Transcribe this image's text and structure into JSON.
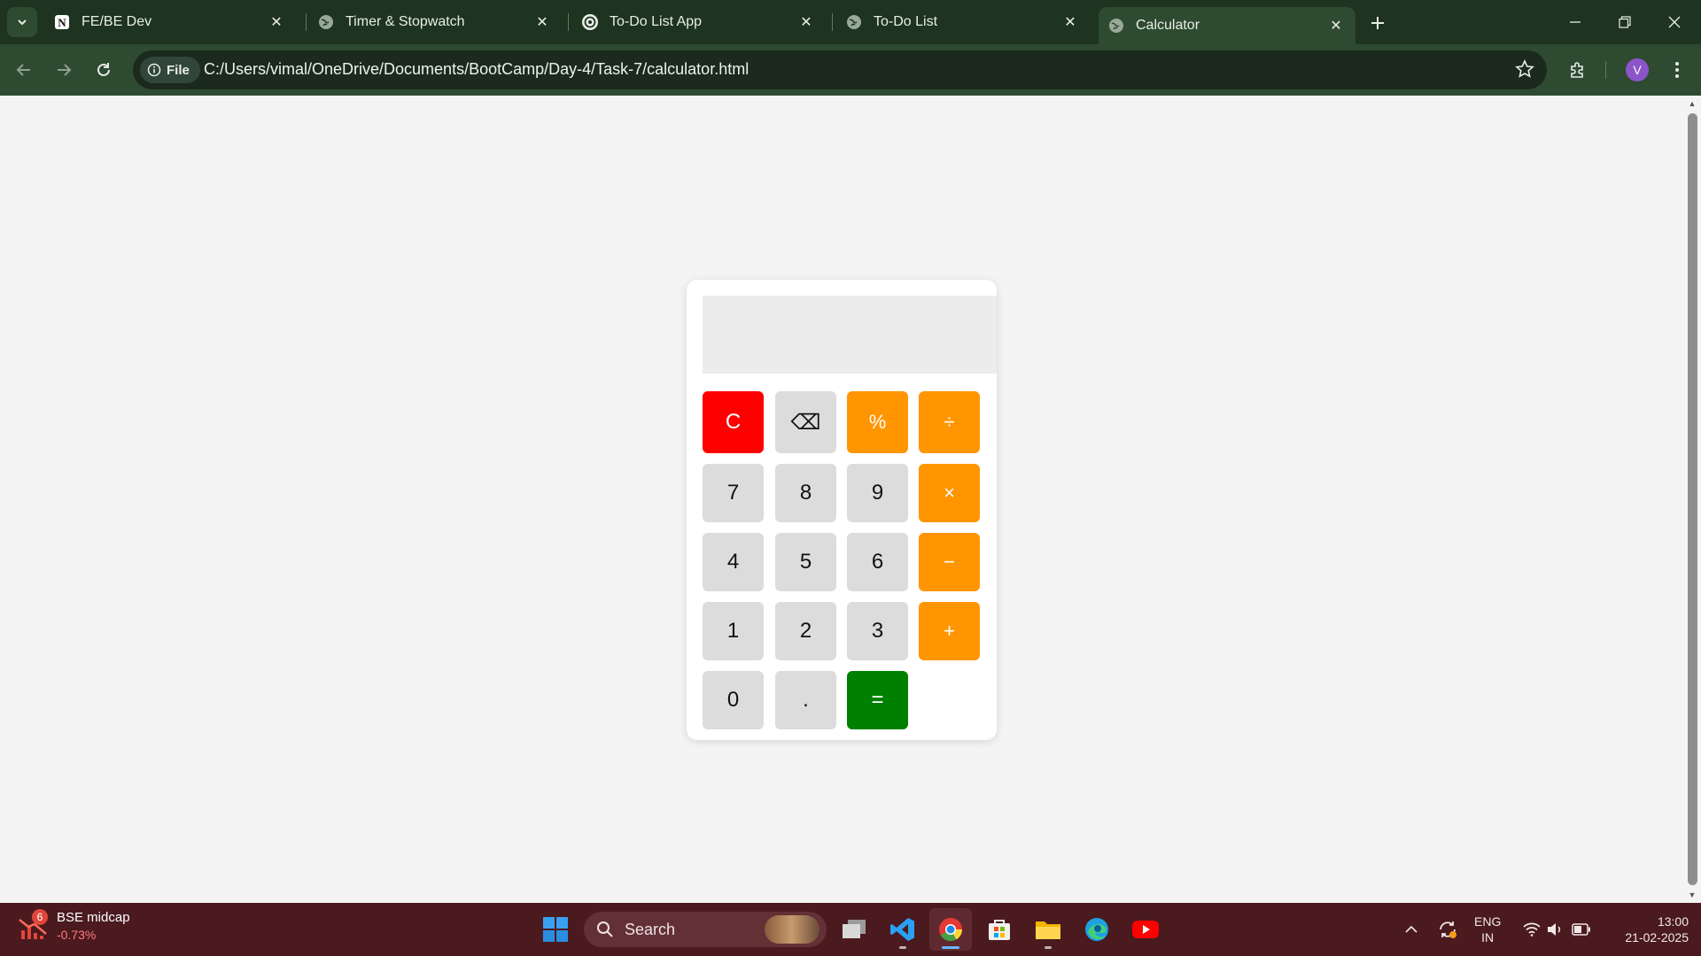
{
  "browser": {
    "tabs": [
      {
        "title": "FE/BE Dev",
        "favicon": "notion-icon",
        "active": false
      },
      {
        "title": "Timer & Stopwatch",
        "favicon": "globe-icon",
        "active": false
      },
      {
        "title": "To-Do List App",
        "favicon": "openai-icon",
        "active": false
      },
      {
        "title": "To-Do List",
        "favicon": "globe-icon",
        "active": false
      },
      {
        "title": "Calculator",
        "favicon": "globe-icon",
        "active": true
      }
    ],
    "address": {
      "scheme_chip": "File",
      "url": "C:/Users/vimal/OneDrive/Documents/BootCamp/Day-4/Task-7/calculator.html"
    },
    "profile_initial": "V"
  },
  "calculator": {
    "display": "",
    "keys": {
      "clear": "C",
      "backspace": "⌫",
      "percent": "%",
      "divide": "÷",
      "seven": "7",
      "eight": "8",
      "nine": "9",
      "multiply": "×",
      "four": "4",
      "five": "5",
      "six": "6",
      "subtract": "−",
      "one": "1",
      "two": "2",
      "three": "3",
      "add": "+",
      "zero": "0",
      "decimal": ".",
      "equals": "="
    },
    "colors": {
      "number": "#dcdcdc",
      "operator": "#ff9500",
      "clear": "#ff0000",
      "equals": "#008000",
      "display": "#ececec"
    }
  },
  "taskbar": {
    "widget": {
      "badge": "6",
      "title": "BSE midcap",
      "change": "-0.73%"
    },
    "search_label": "Search",
    "language": {
      "line1": "ENG",
      "line2": "IN"
    },
    "clock": {
      "time": "13:00",
      "date": "21-02-2025"
    }
  }
}
